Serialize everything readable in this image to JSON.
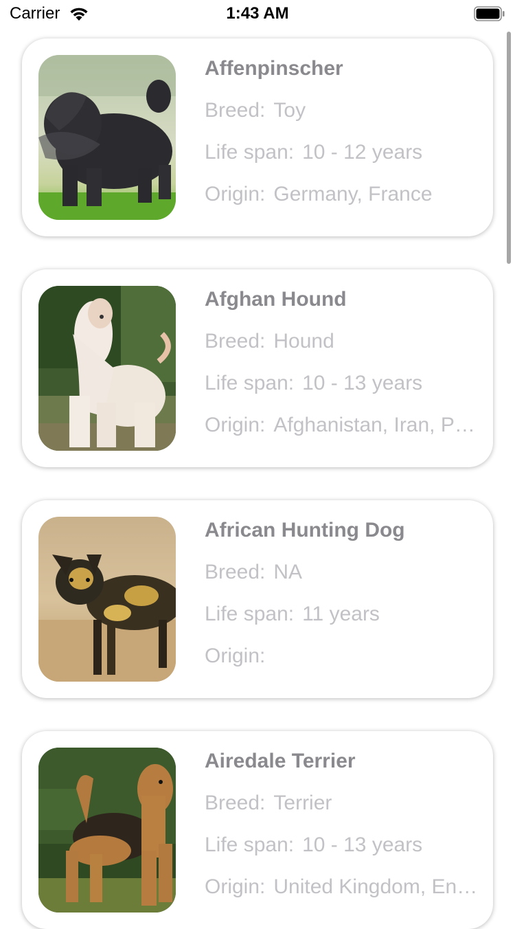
{
  "status_bar": {
    "carrier": "Carrier",
    "time": "1:43 AM",
    "wifi_icon": "wifi-icon",
    "battery_icon": "battery-icon"
  },
  "dogs": [
    {
      "name": "Affenpinscher",
      "breed_label": "Breed:",
      "breed": "Toy",
      "life_label": "Life span:",
      "life_span": "10 - 12 years",
      "origin_label": "Origin:",
      "origin": "Germany, France",
      "photo_icon": "dog-photo-affenpinscher"
    },
    {
      "name": "Afghan Hound",
      "breed_label": "Breed:",
      "breed": "Hound",
      "life_label": "Life span:",
      "life_span": "10 - 13 years",
      "origin_label": "Origin:",
      "origin": "Afghanistan, Iran, Pakistan",
      "photo_icon": "dog-photo-afghan-hound"
    },
    {
      "name": "African Hunting Dog",
      "breed_label": "Breed:",
      "breed": "NA",
      "life_label": "Life span:",
      "life_span": "11 years",
      "origin_label": "Origin:",
      "origin": "",
      "photo_icon": "dog-photo-african-hunting-dog"
    },
    {
      "name": "Airedale Terrier",
      "breed_label": "Breed:",
      "breed": "Terrier",
      "life_label": "Life span:",
      "life_span": "10 - 13 years",
      "origin_label": "Origin:",
      "origin": "United Kingdom, England",
      "photo_icon": "dog-photo-airedale-terrier"
    }
  ],
  "colors": {
    "name_text": "#8a8a8e",
    "field_text": "#c2c2c6",
    "card_background": "#ffffff"
  }
}
